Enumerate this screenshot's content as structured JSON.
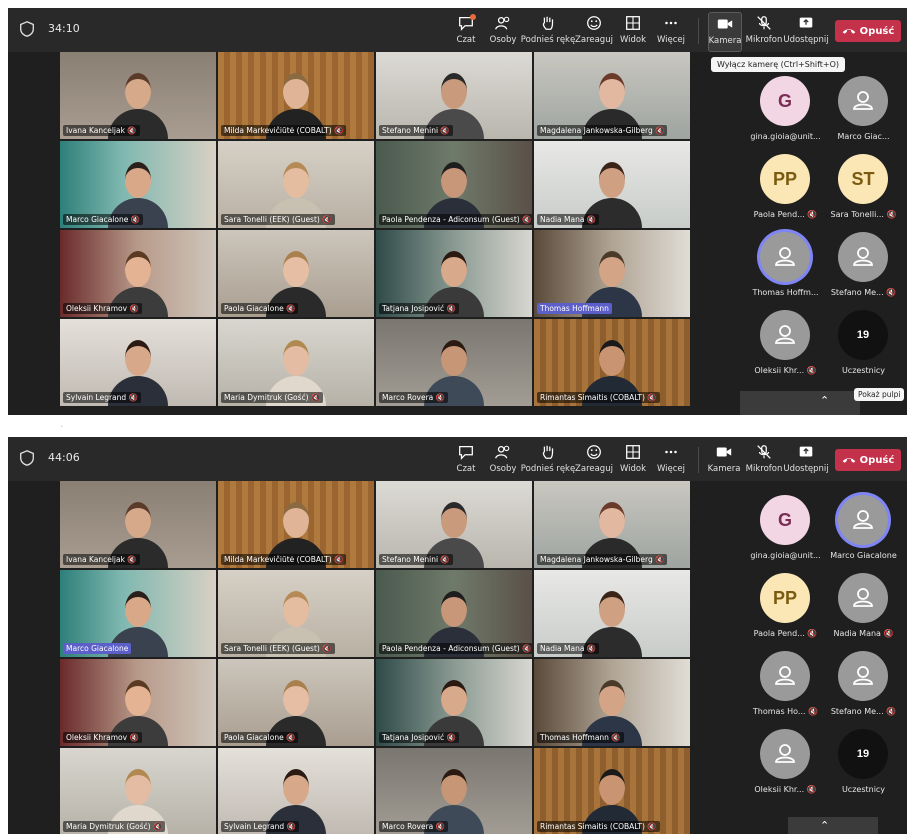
{
  "top": {
    "timer": "34:10",
    "toolbar": {
      "chat": "Czat",
      "people": "Osoby",
      "raise_hand": "Podnieś rękę",
      "react": "Zareaguj",
      "view": "Widok",
      "more": "Więcej",
      "camera": "Kamera",
      "mic": "Mikrofon",
      "share": "Udostępnij",
      "leave": "Opuść"
    },
    "tooltip": "Wyłącz kamerę (Ctrl+Shift+O)",
    "show_all_tip": "Pokaż pulpi",
    "tiles": [
      {
        "name": "Ivana Kanceljak"
      },
      {
        "name": "Milda Markevičiūtė (COBALT)"
      },
      {
        "name": "Stefano Menini"
      },
      {
        "name": "Magdalena Jankowska-Gilberg"
      },
      {
        "name": "Marco Giacalone"
      },
      {
        "name": "Sara Tonelli (EEK) (Guest)"
      },
      {
        "name": "Paola Pendenza - Adiconsum (Guest)"
      },
      {
        "name": "Nadia Mana"
      },
      {
        "name": "Oleksii Khramov"
      },
      {
        "name": "Paola Giacalone"
      },
      {
        "name": "Tatjana Josipović"
      },
      {
        "name": "Thomas Hoffmann"
      },
      {
        "name": "Sylvain Legrand"
      },
      {
        "name": "Maria Dymitruk (Gość)"
      },
      {
        "name": "Marco Rovera"
      },
      {
        "name": "Rimantas Simaitis (COBALT)"
      }
    ],
    "panel": [
      {
        "initials": "G",
        "name": "gina.gioia@unit..."
      },
      {
        "initials": "",
        "name": "Marco Giac..."
      },
      {
        "initials": "PP",
        "name": "Paola Pend..."
      },
      {
        "initials": "ST",
        "name": "Sara Tonelli..."
      },
      {
        "initials": "",
        "name": "Thomas Hoffm..."
      },
      {
        "initials": "",
        "name": "Stefano Me..."
      },
      {
        "initials": "",
        "name": "Oleksii Khr..."
      },
      {
        "initials": "19",
        "name": "Uczestnicy"
      }
    ]
  },
  "bottom": {
    "timer": "44:06",
    "toolbar": {
      "chat": "Czat",
      "people": "Osoby",
      "raise_hand": "Podnieś rękę",
      "react": "Zareaguj",
      "view": "Widok",
      "more": "Więcej",
      "camera": "Kamera",
      "mic": "Mikrofon",
      "share": "Udostępnij",
      "leave": "Opuść"
    },
    "tiles": [
      {
        "name": "Ivana Kanceljak"
      },
      {
        "name": "Milda Markevičiūtė (COBALT)"
      },
      {
        "name": "Stefano Menini"
      },
      {
        "name": "Magdalena Jankowska-Gilberg"
      },
      {
        "name": "Marco Giacalone"
      },
      {
        "name": "Sara Tonelli (EEK) (Guest)"
      },
      {
        "name": "Paola Pendenza - Adiconsum (Guest)"
      },
      {
        "name": "Nadia Mana"
      },
      {
        "name": "Oleksii Khramov"
      },
      {
        "name": "Paola Giacalone"
      },
      {
        "name": "Tatjana Josipović"
      },
      {
        "name": "Thomas Hoffmann"
      },
      {
        "name": "Maria Dymitruk (Gość)"
      },
      {
        "name": "Sylvain Legrand"
      },
      {
        "name": "Marco Rovera"
      },
      {
        "name": "Rimantas Simaitis (COBALT)"
      }
    ],
    "panel": [
      {
        "initials": "G",
        "name": "gina.gioia@unit..."
      },
      {
        "initials": "",
        "name": "Marco Giacalone"
      },
      {
        "initials": "PP",
        "name": "Paola Pend..."
      },
      {
        "initials": "",
        "name": "Nadia Mana"
      },
      {
        "initials": "",
        "name": "Thomas Ho..."
      },
      {
        "initials": "",
        "name": "Stefano Me..."
      },
      {
        "initials": "",
        "name": "Oleksii Khr..."
      },
      {
        "initials": "19",
        "name": "Uczestnicy"
      }
    ]
  },
  "colors": {
    "leave_button": "#c4314b",
    "active_speaker_ring": "#7f85f5",
    "highlight_name": "#5b5fc7"
  }
}
